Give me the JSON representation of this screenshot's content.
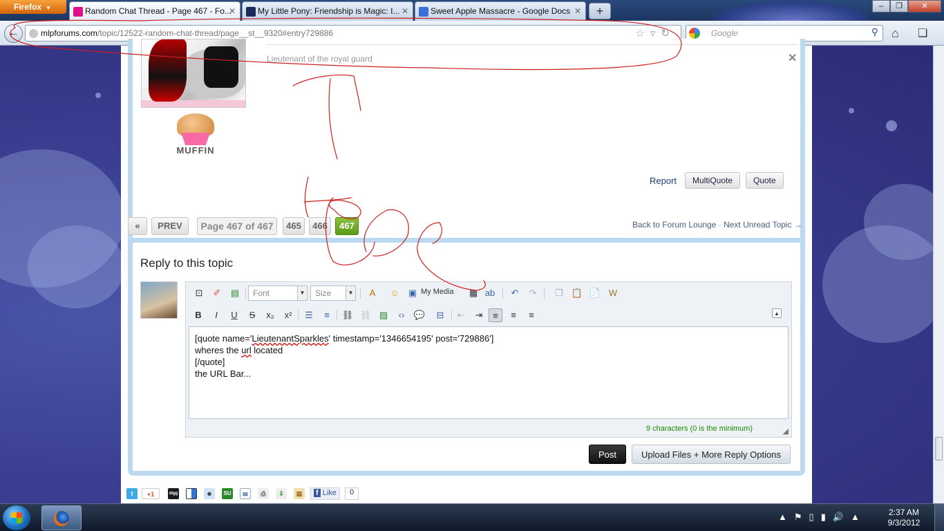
{
  "browser": {
    "menu_button": "Firefox",
    "tabs": [
      {
        "title": "Random Chat Thread - Page 467 - Fo...",
        "icon_color": "#e0108a",
        "active": true
      },
      {
        "title": "My Little Pony: Friendship is Magic: I...",
        "icon_color": "#1b2a5a",
        "active": false
      },
      {
        "title": "Sweet Apple Massacre - Google Docs",
        "icon_color": "#3b6fd8",
        "active": false
      }
    ],
    "new_tab": "+",
    "url_host": "mlpforums.com",
    "url_path": "/topic/12522-random-chat-thread/page__st__9320#entry729886",
    "search_placeholder": "Google",
    "window_buttons": {
      "minimize": "‒",
      "maximize": "❐",
      "close": "✕"
    }
  },
  "post": {
    "member_title": "Lieutenant of the royal guard",
    "badge_label": "MUFFIN",
    "actions": {
      "report": "Report",
      "multiquote": "MultiQuote",
      "quote": "Quote"
    }
  },
  "pagination": {
    "first": "«",
    "prev": "PREV",
    "page_label": "Page 467 of 467",
    "pages": [
      "465",
      "466",
      "467"
    ],
    "current": "467",
    "back_link": "Back to Forum Lounge",
    "separator": "·",
    "next_unread": "Next Unread Topic →"
  },
  "reply": {
    "title": "Reply to this topic",
    "font_select": "Font",
    "size_select": "Size",
    "my_media": "My Media",
    "lines": [
      "[quote name='LieutenantSparkles' timestamp='1346654195' post='729886']",
      "wheres the url located",
      "[/quote]",
      "the URL Bar..."
    ],
    "char_count": "9 characters (0 is the minimum)",
    "post_button": "Post",
    "upload_button": "Upload Files + More Reply Options"
  },
  "share": {
    "icons": [
      "twitter-icon",
      "google-plus-icon",
      "digg-icon",
      "delicious-icon",
      "reddit-icon",
      "stumbleupon-icon",
      "email-icon",
      "print-icon",
      "download-icon",
      "blog-icon"
    ],
    "google_plus_label": "+1",
    "stumble_label": "SU",
    "digg_label": "digg",
    "fb_like": "Like",
    "fb_count": "0"
  },
  "taskbar": {
    "time": "2:37 AM",
    "date": "9/3/2012"
  },
  "colors": {
    "annotation": "#cc1f1f",
    "page_active": "#6aa820",
    "panel_border": "#bcd9f2"
  }
}
